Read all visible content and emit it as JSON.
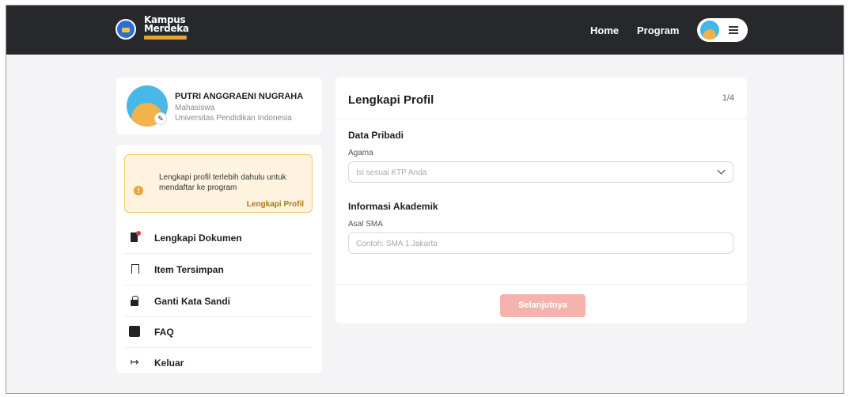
{
  "header": {
    "logo_line1": "Kampus",
    "logo_line2": "Merdeka",
    "nav": {
      "home": "Home",
      "program": "Program"
    },
    "menu_icon": "hamburger-icon"
  },
  "profile": {
    "name": "PUTRI ANGGRAENI NUGRAHA",
    "role": "Mahasiswa",
    "university": "Universitas Pendidikan Indonesia"
  },
  "sidebar": {
    "alert": {
      "text": "Lengkapi profil terlebih dahulu untuk mendaftar ke program",
      "link": "Lengkapi Profil"
    },
    "items": [
      {
        "label": "Lengkapi Dokumen",
        "icon": "document-icon"
      },
      {
        "label": "Item Tersimpan",
        "icon": "bookmark-icon"
      },
      {
        "label": "Ganti Kata Sandi",
        "icon": "lock-icon"
      },
      {
        "label": "FAQ",
        "icon": "question-icon"
      },
      {
        "label": "Keluar",
        "icon": "logout-icon"
      }
    ]
  },
  "form": {
    "title": "Lengkapi Profil",
    "step": "1/4",
    "section_personal": "Data Pribadi",
    "religion_label": "Agama",
    "religion_placeholder": "Isi sesuai KTP Anda",
    "section_academic": "Informasi Akademik",
    "school_label": "Asal SMA",
    "school_placeholder": "Contoh: SMA 1 Jakarta",
    "next_button": "Selanjutnya"
  },
  "colors": {
    "topbar": "#27282c",
    "alert_bg": "#fdf3df",
    "alert_border": "#f0c76a",
    "button_disabled": "#f5b3ad",
    "page_bg": "#f4f4f6"
  }
}
